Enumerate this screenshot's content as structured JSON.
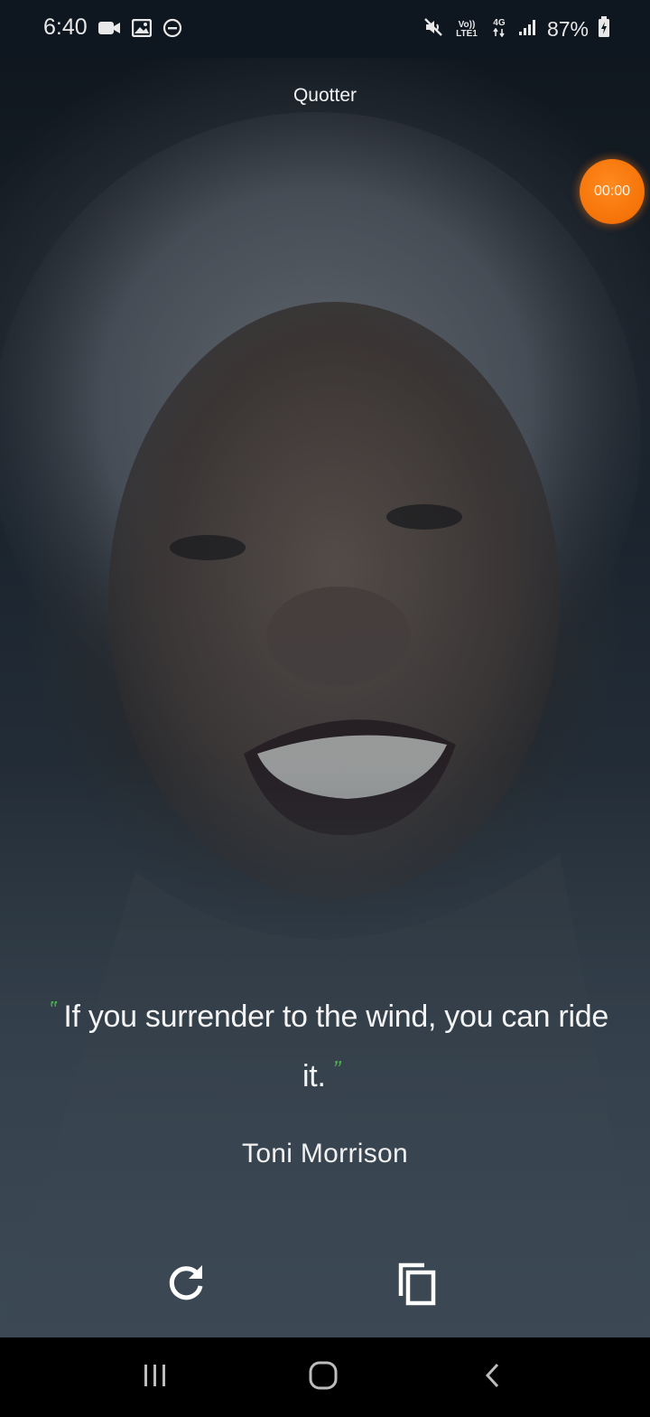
{
  "status_bar": {
    "time": "6:40",
    "left_icons": [
      "video-camera-icon",
      "image-icon",
      "do-not-disturb-icon"
    ],
    "volte_label": "Vo)) LTE1",
    "network_label": "4G",
    "battery_percent": "87%",
    "right_icons": [
      "mute-icon",
      "signal-icon",
      "battery-charging-icon"
    ]
  },
  "app": {
    "title": "Quotter",
    "timer": "00:00",
    "quote_open_mark": "‟",
    "quote_close_mark": "”",
    "quote": "If you surrender to the wind, you can ride it.",
    "author": "Toni Morrison",
    "accent_color": "#4caf50",
    "timer_color": "#f57308"
  },
  "actions": {
    "refresh_icon": "refresh-icon",
    "copy_icon": "copy-icon"
  },
  "nav_bar": {
    "buttons": [
      "recents",
      "home",
      "back"
    ]
  }
}
